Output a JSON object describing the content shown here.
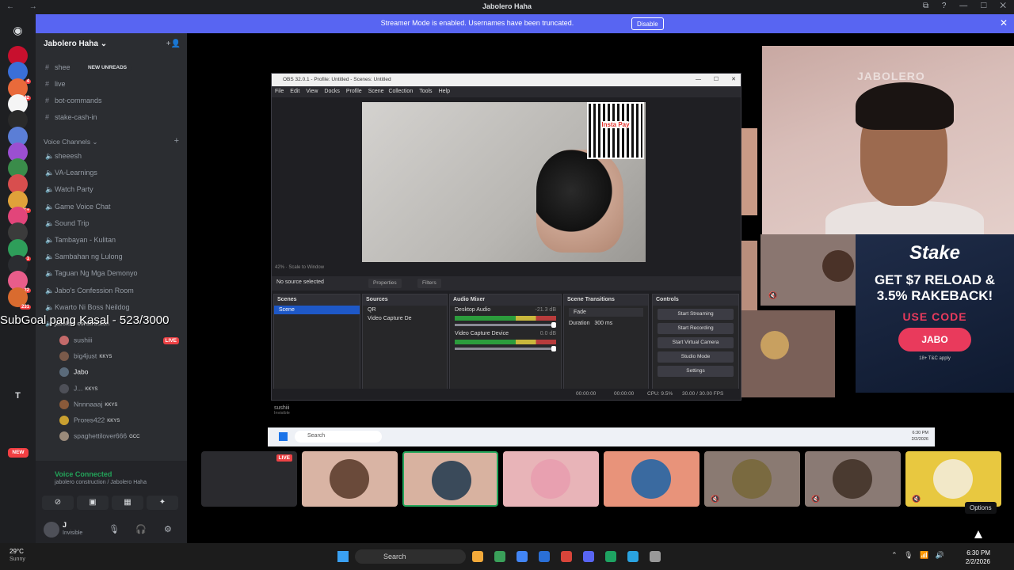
{
  "window": {
    "title": "Jabolero Haha",
    "nav": "← →",
    "controls": "⧉ ? — ☐ ✕"
  },
  "banner": {
    "message": "Streamer Mode is enabled. Usernames have been truncated.",
    "disable_label": "Disable",
    "close": "✕"
  },
  "guilds": [
    {
      "color": "#c8102e",
      "badge": ""
    },
    {
      "color": "#3a6fd8",
      "badge": "4"
    },
    {
      "color": "#e96a3b",
      "badge": "142"
    },
    {
      "color": "#f5f5f5",
      "badge": ""
    },
    {
      "color": "#2a2a2a",
      "badge": ""
    },
    {
      "color": "#5b7ed6",
      "badge": ""
    },
    {
      "color": "#9b4fd1",
      "badge": ""
    },
    {
      "color": "#3a8c4a",
      "badge": ""
    },
    {
      "color": "#d84e4e",
      "badge": ""
    },
    {
      "color": "#e0a23a",
      "badge": "1K+"
    },
    {
      "color": "#e2457a",
      "badge": ""
    },
    {
      "color": "#3b3b3b",
      "badge": ""
    },
    {
      "color": "#2e9e5a",
      "badge": "1"
    },
    {
      "color": "#2b2d31",
      "badge": ""
    },
    {
      "color": "#e85d8a",
      "badge": "22"
    },
    {
      "color": "#d96b2f",
      "badge": "231"
    }
  ],
  "guild_letter": "T",
  "guild_new": "NEW",
  "server": {
    "name": "Jabolero Haha ⌄",
    "new_unreads": "NEW UNREADS",
    "text_channels": [
      {
        "icon": "#",
        "name": "shee"
      },
      {
        "icon": "#",
        "name": "live"
      },
      {
        "icon": "#",
        "name": "bot-commands"
      },
      {
        "icon": "#",
        "name": "stake-cash-in"
      }
    ],
    "voice_category": "Voice Channels ⌄",
    "voice_channels": [
      "sheeesh",
      "VA-Learnings",
      "Watch Party",
      "Game Voice Chat",
      "Sound Trip",
      "Tambayan - Kulitan",
      "Sambahan ng Lulong",
      "Taguan Ng Mga Demonyo",
      "Jabo's Confession Room",
      "Kwarto Ni Boss Neildog",
      "jabolero construction"
    ],
    "voice_users": [
      {
        "name": "sushiii",
        "tag": "",
        "live": "LIVE",
        "color": "#c46a6a"
      },
      {
        "name": "big4just",
        "tag": "KKYS",
        "live": "",
        "color": "#7a5a4a"
      },
      {
        "name": "Jabo",
        "tag": "",
        "live": "",
        "color": "#5a6a7a"
      },
      {
        "name": "J...",
        "tag": "KKYS",
        "live": "",
        "color": "#4e5058"
      },
      {
        "name": "Nnnnaaaj",
        "tag": "KKYS",
        "live": "",
        "color": "#8a5a3a"
      },
      {
        "name": "Prores422",
        "tag": "KKYS",
        "live": "",
        "color": "#c9a030"
      },
      {
        "name": "spaghettilover666",
        "tag": "GCC",
        "live": "",
        "color": "#9a8a7a"
      }
    ]
  },
  "overlay": {
    "subgoal": "SubGoal pang Kasal - 523/3000"
  },
  "voice_panel": {
    "status": "Voice Connected",
    "channel": "jabolero construction / Jabolero Haha"
  },
  "user_panel": {
    "name": "J",
    "status": "Invisible"
  },
  "obs": {
    "title": "OBS 32.0.1 - Profile: Untitled - Scenes: Untitled",
    "menu": [
      "File",
      "Edit",
      "View",
      "Docks",
      "Profile",
      "Scene Collection",
      "Tools",
      "Help"
    ],
    "qr_label": "Insta Pay",
    "scaling": "42%  ·  Scale to Window",
    "no_source": "No source selected",
    "properties": "Properties",
    "filters": "Filters",
    "scenes_header": "Scenes",
    "scene": "Scene",
    "sources_header": "Sources",
    "sources": [
      "QR",
      "Video Capture De"
    ],
    "mixer_header": "Audio Mixer",
    "mixer": [
      {
        "name": "Desktop Audio",
        "db": "-21.3 dB"
      },
      {
        "name": "Video Capture Device",
        "db": "0.0 dB"
      }
    ],
    "transitions_header": "Scene Transitions",
    "transition": "Fade",
    "duration_label": "Duration",
    "duration": "300 ms",
    "controls_header": "Controls",
    "controls": [
      "Start Streaming",
      "Start Recording",
      "Start Virtual Camera",
      "Studio Mode",
      "Settings"
    ],
    "status": {
      "t1": "00:00:00",
      "t2": "00:00:00",
      "cpu": "CPU: 9.5%",
      "fps": "30.00 / 30.00 FPS"
    }
  },
  "inner_desktop": {
    "user": "sushiii",
    "user_status": "Invisible",
    "search": "Search",
    "clock_time": "6:30 PM",
    "clock_date": "2/2/2026"
  },
  "stream_overlay": {
    "watermark": "JABOLERO"
  },
  "stake": {
    "logo": "Stake",
    "promo1": "GET $7 RELOAD &",
    "promo2": "3.5% RAKEBACK!",
    "code_label": "USE CODE",
    "code": "JABO",
    "tc": "18+ T&C apply"
  },
  "tiles": [
    {
      "bg": "#2a2a2e",
      "av": "",
      "live": "LIVE"
    },
    {
      "bg": "#d9b4a4",
      "av": "#6a4a3a",
      "live": ""
    },
    {
      "bg": "#d8b2a0",
      "av": "#3a4a5a",
      "live": ""
    },
    {
      "bg": "#e8b4b8",
      "av": "#e8a0b0",
      "live": ""
    },
    {
      "bg": "#e8937a",
      "av": "#3a6aa0",
      "live": ""
    },
    {
      "bg": "#8a7a72",
      "av": "#7a6a40",
      "live": ""
    },
    {
      "bg": "#8a7a74",
      "av": "#4a3a30",
      "live": ""
    },
    {
      "bg": "#e8c840",
      "av": "#f2e8c8",
      "live": ""
    }
  ],
  "options_tip": "Options",
  "taskbar": {
    "temp": "29°C",
    "condition": "Sunny",
    "search": "Search",
    "time": "6:30 PM",
    "date": "2/2/2026",
    "apps": [
      "#f2a93a",
      "#3aa05a",
      "#4285f4",
      "#2a6fd6",
      "#d8453a",
      "#5865f2",
      "#1ea362",
      "#2aa3e0",
      "#999999"
    ]
  }
}
